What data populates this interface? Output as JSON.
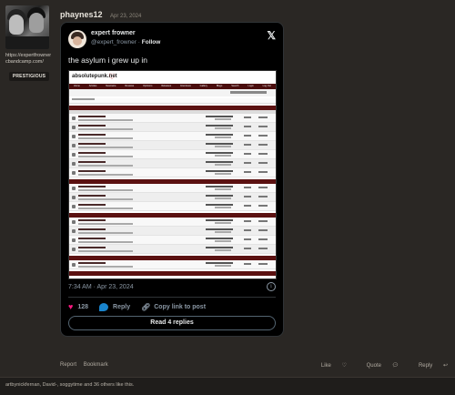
{
  "post": {
    "author": "phaynes12",
    "date": "Apr 23, 2024",
    "user_link": "https://expertfrownercbandcamp.com/",
    "badge": "PRESTIGIOUS"
  },
  "tweet": {
    "name": "expert frowner",
    "handle": "@expert_frowner",
    "follow_label": "Follow",
    "x_icon": "x-logo-icon",
    "text": "the asylum i grew up in",
    "screenshot": {
      "logo": "absolutepunk.net",
      "nav": [
        "Home",
        "Articles",
        "Newswire",
        "Reviews",
        "Opinions",
        "Releases",
        "Interviews",
        "Gallery",
        "Blogs",
        "Search",
        "Login",
        "Log Out"
      ]
    },
    "time": "7:34 AM · Apr 23, 2024",
    "likes": "128",
    "reply_label": "Reply",
    "copy_label": "Copy link to post",
    "read_replies": "Read 4 replies"
  },
  "footer": {
    "report": "Report",
    "bookmark": "Bookmark",
    "like": "Like",
    "quote": "Quote",
    "reply": "Reply"
  },
  "likes_text": "artbynickfernan, David-, soggytime and 36 others like this."
}
